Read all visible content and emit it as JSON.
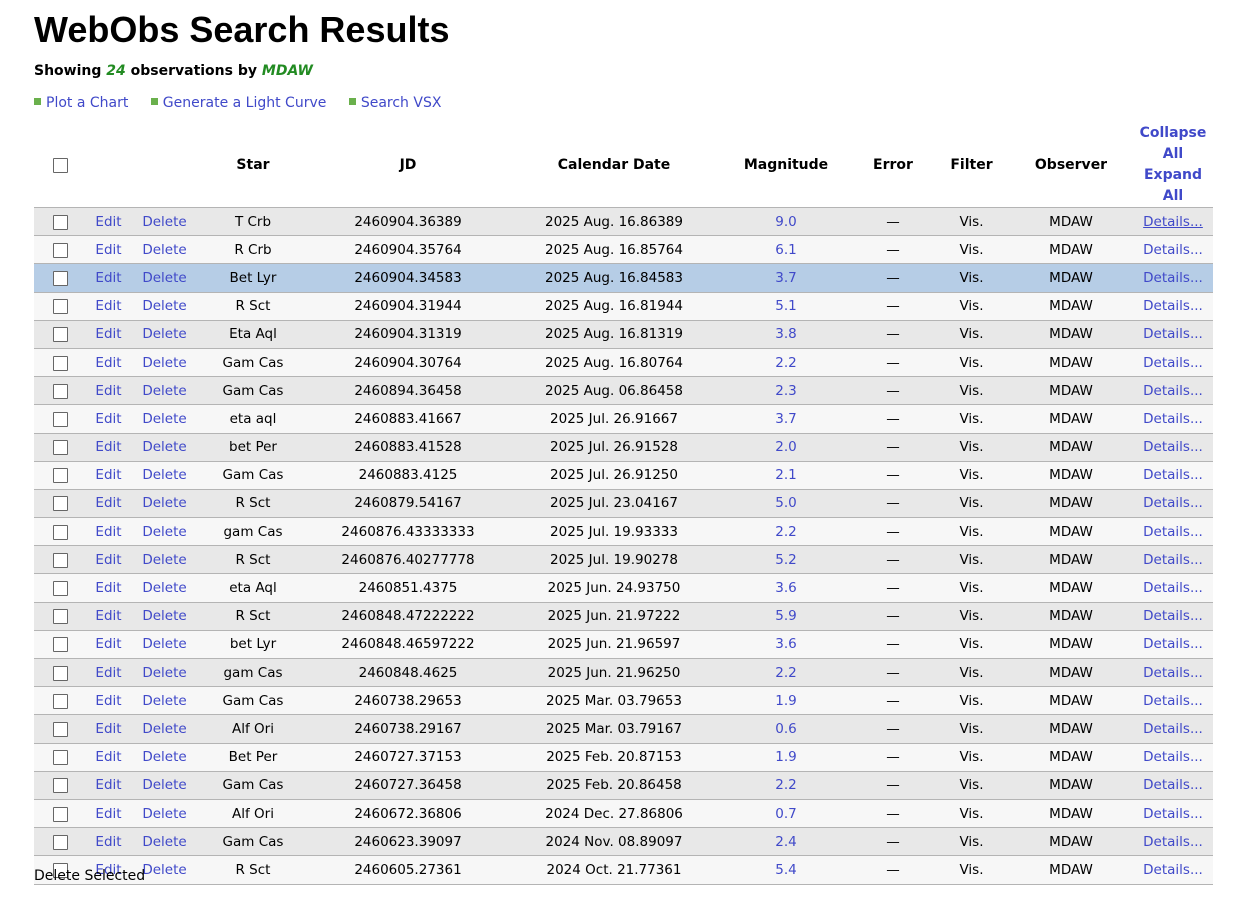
{
  "page": {
    "title": "WebObs Search Results",
    "showing_prefix": "Showing",
    "count": "24",
    "showing_mid": "observations by",
    "observer_code": "MDAW"
  },
  "links": [
    {
      "label": "Plot a Chart"
    },
    {
      "label": "Generate a Light Curve"
    },
    {
      "label": "Search VSX"
    }
  ],
  "table": {
    "headers": {
      "star": "Star",
      "jd": "JD",
      "date": "Calendar Date",
      "magnitude": "Magnitude",
      "error": "Error",
      "filter": "Filter",
      "observer": "Observer",
      "collapse_expand": "Collapse All Expand All"
    },
    "edit_label": "Edit",
    "delete_label": "Delete",
    "details_label": "Details...",
    "rows": [
      {
        "star": "T Crb",
        "jd": "2460904.36389",
        "date": "2025 Aug. 16.86389",
        "mag": "9.0",
        "err": "—",
        "filter": "Vis.",
        "obs": "MDAW"
      },
      {
        "star": "R Crb",
        "jd": "2460904.35764",
        "date": "2025 Aug. 16.85764",
        "mag": "6.1",
        "err": "—",
        "filter": "Vis.",
        "obs": "MDAW"
      },
      {
        "star": "Bet Lyr",
        "jd": "2460904.34583",
        "date": "2025 Aug. 16.84583",
        "mag": "3.7",
        "err": "—",
        "filter": "Vis.",
        "obs": "MDAW"
      },
      {
        "star": "R Sct",
        "jd": "2460904.31944",
        "date": "2025 Aug. 16.81944",
        "mag": "5.1",
        "err": "—",
        "filter": "Vis.",
        "obs": "MDAW"
      },
      {
        "star": "Eta Aql",
        "jd": "2460904.31319",
        "date": "2025 Aug. 16.81319",
        "mag": "3.8",
        "err": "—",
        "filter": "Vis.",
        "obs": "MDAW"
      },
      {
        "star": "Gam Cas",
        "jd": "2460904.30764",
        "date": "2025 Aug. 16.80764",
        "mag": "2.2",
        "err": "—",
        "filter": "Vis.",
        "obs": "MDAW"
      },
      {
        "star": "Gam Cas",
        "jd": "2460894.36458",
        "date": "2025 Aug. 06.86458",
        "mag": "2.3",
        "err": "—",
        "filter": "Vis.",
        "obs": "MDAW"
      },
      {
        "star": "eta aql",
        "jd": "2460883.41667",
        "date": "2025 Jul. 26.91667",
        "mag": "3.7",
        "err": "—",
        "filter": "Vis.",
        "obs": "MDAW"
      },
      {
        "star": "bet Per",
        "jd": "2460883.41528",
        "date": "2025 Jul. 26.91528",
        "mag": "2.0",
        "err": "—",
        "filter": "Vis.",
        "obs": "MDAW"
      },
      {
        "star": "Gam Cas",
        "jd": "2460883.4125",
        "date": "2025 Jul. 26.91250",
        "mag": "2.1",
        "err": "—",
        "filter": "Vis.",
        "obs": "MDAW"
      },
      {
        "star": "R Sct",
        "jd": "2460879.54167",
        "date": "2025 Jul. 23.04167",
        "mag": "5.0",
        "err": "—",
        "filter": "Vis.",
        "obs": "MDAW"
      },
      {
        "star": "gam Cas",
        "jd": "2460876.43333333",
        "date": "2025 Jul. 19.93333",
        "mag": "2.2",
        "err": "—",
        "filter": "Vis.",
        "obs": "MDAW"
      },
      {
        "star": "R Sct",
        "jd": "2460876.40277778",
        "date": "2025 Jul. 19.90278",
        "mag": "5.2",
        "err": "—",
        "filter": "Vis.",
        "obs": "MDAW"
      },
      {
        "star": "eta Aql",
        "jd": "2460851.4375",
        "date": "2025 Jun. 24.93750",
        "mag": "3.6",
        "err": "—",
        "filter": "Vis.",
        "obs": "MDAW"
      },
      {
        "star": "R Sct",
        "jd": "2460848.47222222",
        "date": "2025 Jun. 21.97222",
        "mag": "5.9",
        "err": "—",
        "filter": "Vis.",
        "obs": "MDAW"
      },
      {
        "star": "bet Lyr",
        "jd": "2460848.46597222",
        "date": "2025 Jun. 21.96597",
        "mag": "3.6",
        "err": "—",
        "filter": "Vis.",
        "obs": "MDAW"
      },
      {
        "star": "gam Cas",
        "jd": "2460848.4625",
        "date": "2025 Jun. 21.96250",
        "mag": "2.2",
        "err": "—",
        "filter": "Vis.",
        "obs": "MDAW"
      },
      {
        "star": "Gam Cas",
        "jd": "2460738.29653",
        "date": "2025 Mar. 03.79653",
        "mag": "1.9",
        "err": "—",
        "filter": "Vis.",
        "obs": "MDAW"
      },
      {
        "star": "Alf Ori",
        "jd": "2460738.29167",
        "date": "2025 Mar. 03.79167",
        "mag": "0.6",
        "err": "—",
        "filter": "Vis.",
        "obs": "MDAW"
      },
      {
        "star": "Bet Per",
        "jd": "2460727.37153",
        "date": "2025 Feb. 20.87153",
        "mag": "1.9",
        "err": "—",
        "filter": "Vis.",
        "obs": "MDAW"
      },
      {
        "star": "Gam Cas",
        "jd": "2460727.36458",
        "date": "2025 Feb. 20.86458",
        "mag": "2.2",
        "err": "—",
        "filter": "Vis.",
        "obs": "MDAW"
      },
      {
        "star": "Alf Ori",
        "jd": "2460672.36806",
        "date": "2024 Dec. 27.86806",
        "mag": "0.7",
        "err": "—",
        "filter": "Vis.",
        "obs": "MDAW"
      },
      {
        "star": "Gam Cas",
        "jd": "2460623.39097",
        "date": "2024 Nov. 08.89097",
        "mag": "2.4",
        "err": "—",
        "filter": "Vis.",
        "obs": "MDAW"
      },
      {
        "star": "R Sct",
        "jd": "2460605.27361",
        "date": "2024 Oct. 21.77361",
        "mag": "5.4",
        "err": "—",
        "filter": "Vis.",
        "obs": "MDAW"
      }
    ]
  },
  "footer": {
    "delete_selected": "Delete Selected"
  }
}
